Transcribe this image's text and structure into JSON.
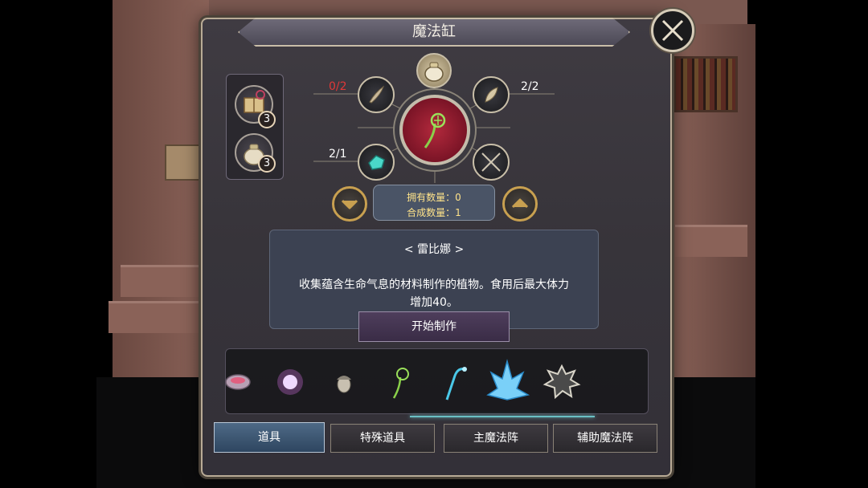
{
  "window": {
    "title": "魔法缸"
  },
  "owned_items": [
    {
      "icon": "recipe-book-icon",
      "count": "3"
    },
    {
      "icon": "sack-icon",
      "count": "3"
    }
  ],
  "recipe": {
    "top_slot_icon": "sack-icon",
    "slots": [
      {
        "id": "top-left",
        "icon": "feather-icon",
        "ratio": "0/2",
        "insufficient": true
      },
      {
        "id": "top-right",
        "icon": "leaf-icon",
        "ratio": "2/2",
        "insufficient": false
      },
      {
        "id": "bottom-left",
        "icon": "crystal-gem-icon",
        "ratio": "2/1",
        "insufficient": false
      },
      {
        "id": "bottom-right",
        "icon": "empty-x-icon",
        "ratio": "",
        "insufficient": false
      }
    ],
    "result_icon": "sprout-plant-icon",
    "owned_label": "拥有数量：0",
    "craft_count_label": "合成数量：1"
  },
  "item": {
    "name": "< 雷比娜 >",
    "description_line1": "收集蕴含生命气息的材料制作的植物。食用后最大体力",
    "description_line2": "增加40。"
  },
  "craft_button": "开始制作",
  "materials": [
    {
      "icon": "bowl-icon"
    },
    {
      "icon": "glowing-orb-icon"
    },
    {
      "icon": "acorn-icon"
    },
    {
      "icon": "sprout-plant-icon"
    },
    {
      "icon": "blue-wand-icon"
    },
    {
      "icon": "ice-crystal-icon"
    },
    {
      "icon": "spiky-ore-icon"
    }
  ],
  "tabs": [
    {
      "label": "道具",
      "active": true
    },
    {
      "label": "特殊道具",
      "active": false
    },
    {
      "label": "主魔法阵",
      "active": false
    },
    {
      "label": "辅助魔法阵",
      "active": false
    }
  ],
  "colors": {
    "insufficient": "#e03838",
    "count_text": "#ffe38a",
    "result_bg": "#b2293c",
    "active_tab": "#4e6a86"
  }
}
